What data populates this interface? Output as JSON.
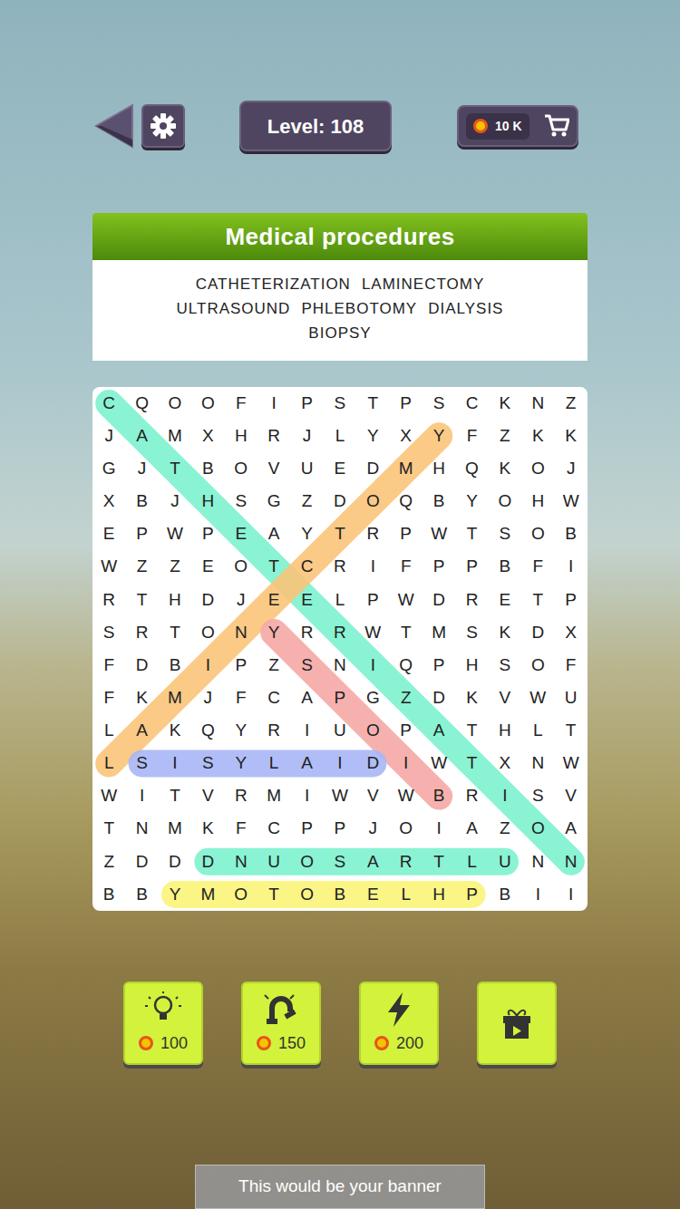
{
  "top_bar": {
    "level": "Level: 108",
    "coins": "10 K"
  },
  "header": {
    "title": "Medical procedures"
  },
  "words": [
    "CATHETERIZATION",
    "LAMINECTOMY",
    "ULTRASOUND",
    "PHLEBOTOMY",
    "DIALYSIS",
    "BIOPSY"
  ],
  "grid": {
    "rows": [
      [
        "C",
        "Q",
        "O",
        "O",
        "F",
        "I",
        "P",
        "S",
        "T",
        "P",
        "S",
        "C",
        "K",
        "N",
        "Z"
      ],
      [
        "J",
        "A",
        "M",
        "X",
        "H",
        "R",
        "J",
        "L",
        "Y",
        "X",
        "Y",
        "F",
        "Z",
        "K",
        "K"
      ],
      [
        "G",
        "J",
        "T",
        "B",
        "O",
        "V",
        "U",
        "E",
        "D",
        "M",
        "H",
        "Q",
        "K",
        "O",
        "J"
      ],
      [
        "X",
        "B",
        "J",
        "H",
        "S",
        "G",
        "Z",
        "D",
        "O",
        "Q",
        "B",
        "Y",
        "O",
        "H",
        "W"
      ],
      [
        "E",
        "P",
        "W",
        "P",
        "E",
        "A",
        "Y",
        "T",
        "R",
        "P",
        "W",
        "T",
        "S",
        "O",
        "B"
      ],
      [
        "W",
        "Z",
        "Z",
        "E",
        "O",
        "T",
        "C",
        "R",
        "I",
        "F",
        "P",
        "P",
        "B",
        "F",
        "I"
      ],
      [
        "R",
        "T",
        "H",
        "D",
        "J",
        "E",
        "E",
        "L",
        "P",
        "W",
        "D",
        "R",
        "E",
        "T",
        "P"
      ],
      [
        "S",
        "R",
        "T",
        "O",
        "N",
        "Y",
        "R",
        "R",
        "W",
        "T",
        "M",
        "S",
        "K",
        "D",
        "X"
      ],
      [
        "F",
        "D",
        "B",
        "I",
        "P",
        "Z",
        "S",
        "N",
        "I",
        "Q",
        "P",
        "H",
        "S",
        "O",
        "F"
      ],
      [
        "F",
        "K",
        "M",
        "J",
        "F",
        "C",
        "A",
        "P",
        "G",
        "Z",
        "D",
        "K",
        "V",
        "W",
        "U"
      ],
      [
        "L",
        "A",
        "K",
        "Q",
        "Y",
        "R",
        "I",
        "U",
        "O",
        "P",
        "A",
        "T",
        "H",
        "L",
        "T"
      ],
      [
        "L",
        "S",
        "I",
        "S",
        "Y",
        "L",
        "A",
        "I",
        "D",
        "I",
        "W",
        "T",
        "X",
        "N",
        "W"
      ],
      [
        "W",
        "I",
        "T",
        "V",
        "R",
        "M",
        "I",
        "W",
        "V",
        "W",
        "B",
        "R",
        "I",
        "S",
        "V"
      ],
      [
        "T",
        "N",
        "M",
        "K",
        "F",
        "C",
        "P",
        "P",
        "J",
        "O",
        "I",
        "A",
        "Z",
        "O",
        "A"
      ],
      [
        "Z",
        "D",
        "D",
        "D",
        "N",
        "U",
        "O",
        "S",
        "A",
        "R",
        "T",
        "L",
        "U",
        "N",
        "N"
      ],
      [
        "B",
        "B",
        "Y",
        "M",
        "O",
        "T",
        "O",
        "B",
        "E",
        "L",
        "H",
        "P",
        "B",
        "I",
        "I"
      ]
    ]
  },
  "highlights": [
    {
      "from": [
        0,
        0
      ],
      "to": [
        14,
        14
      ],
      "color": "#7ef2cf"
    },
    {
      "from": [
        11,
        0
      ],
      "to": [
        1,
        10
      ],
      "color": "#fbc579"
    },
    {
      "from": [
        7,
        5
      ],
      "to": [
        12,
        10
      ],
      "color": "#f6a9a6"
    },
    {
      "from": [
        11,
        1
      ],
      "to": [
        11,
        8
      ],
      "color": "#a9b6f6"
    },
    {
      "from": [
        14,
        3
      ],
      "to": [
        14,
        12
      ],
      "color": "#7ef2cf"
    },
    {
      "from": [
        15,
        2
      ],
      "to": [
        15,
        11
      ],
      "color": "#fbf57a"
    }
  ],
  "boosters": [
    {
      "kind": "hint",
      "cost": "100"
    },
    {
      "kind": "magnet",
      "cost": "150"
    },
    {
      "kind": "bolt",
      "cost": "200"
    },
    {
      "kind": "gift"
    }
  ],
  "banner": "This would be your banner"
}
